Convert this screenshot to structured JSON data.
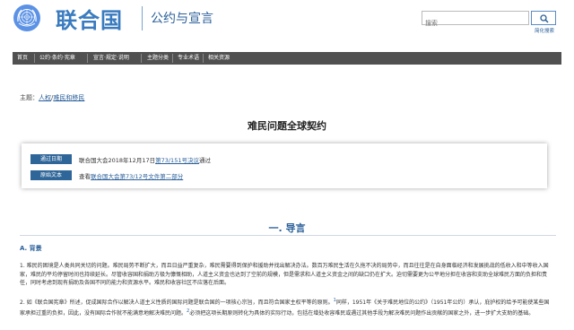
{
  "header": {
    "brand": "联合国",
    "subtitle": "公约与宣言",
    "search_placeholder": "搜索",
    "advanced_search": "简化搜索"
  },
  "nav": {
    "items": [
      "首页",
      "公约·条约·宪章",
      "宣言·规定·说明",
      "主题分类",
      "专业术语",
      "相关资源"
    ]
  },
  "breadcrumb": {
    "prefix": "主题：",
    "level1": "人权",
    "sep": "/",
    "level2": "难民和移民"
  },
  "page": {
    "title": "难民问题全球契约"
  },
  "info": {
    "adopted_label": "通过日期",
    "adopted_prefix": "联合国大会2018年12月17日",
    "adopted_link": "第73/151号决议",
    "adopted_suffix": "通过",
    "source_label": "原始文本",
    "source_prefix": "查看",
    "source_link": "联合国大会第73/12号文件第二部分"
  },
  "content": {
    "section_title": "一. 导言",
    "sub_heading": "A. 背景",
    "para1": "1. 难民的困境是人类共同关切的问题。难民局势不断扩大，而且日益严重复杂，难民需要得到保护和援助并找出解决办法。数百万难民生活在久拖不决的局势中，而且往往是在自身面临经济和发展挑战的低收入和中等收入国家，难民的平均停留时间也持续延长。尽管收容国和捐助方极为慷慨相助，人道主义资金也达到了空前的规模，但是需求和人道主义资金之间的缺口仍在扩大。迫切需要更为公平地分担在收容和支助全球难民方面的负担和责任，同时考虑到现有捐助及各国不同的能力和资源水平。难民和收容社区不应落在后面。",
    "para2_a": "2. 如《联合国宪章》所述，促成国际合作以解决人道主义性质的国际问题是联合国的一项核心宗旨，而且符合国家主权平等的原则。",
    "para2_sup1": "1",
    "para2_b": "同样，1951年《关于难民地位的公约》（1951年公约）承认，庇护权的给予可能使某些国家承担过重的负担，因此，没有国际合作就不能满意地解决难民问题。",
    "para2_sup2": "2",
    "para2_c": "必须把这项长期原则转化为具体的实际行动，包括在增处收容难民或遇过其他手段为解决难民问题作出贡献的国家之外，进一步扩大支助的基础。"
  }
}
